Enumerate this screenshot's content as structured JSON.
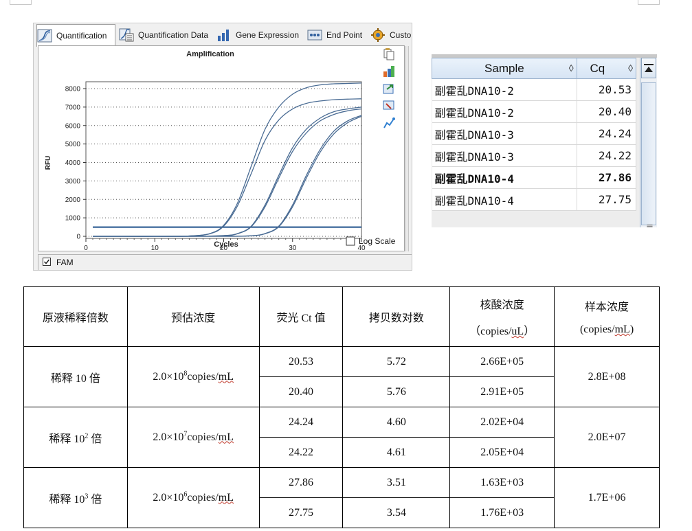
{
  "tabs": [
    {
      "label": "Quantification",
      "icon": "quantification-icon",
      "active": true
    },
    {
      "label": "Quantification Data",
      "icon": "quantification-data-icon",
      "active": false
    },
    {
      "label": "Gene Expression",
      "icon": "gene-expression-icon",
      "active": false
    },
    {
      "label": "End Point",
      "icon": "end-point-icon",
      "active": false
    },
    {
      "label": "Custo",
      "icon": "custom-gear-icon",
      "active": false
    }
  ],
  "fam_label": "FAM",
  "log_scale_label": "Log Scale",
  "chart_data": {
    "type": "line",
    "title": "Amplification",
    "xlabel": "Cycles",
    "ylabel": "RFU",
    "xlim": [
      0,
      40
    ],
    "ylim": [
      0,
      8000
    ],
    "xticks": [
      0,
      10,
      20,
      30,
      40
    ],
    "yticks": [
      0,
      1000,
      2000,
      3000,
      4000,
      5000,
      6000,
      7000,
      8000
    ],
    "grid": true,
    "threshold": 500,
    "line_color": "#4a6c94",
    "series": [
      {
        "x": [
          1,
          5,
          10,
          15,
          18,
          20,
          22,
          24,
          26,
          28,
          30,
          32,
          34,
          36,
          38,
          40
        ],
        "y": [
          0,
          0,
          0,
          20,
          150,
          600,
          1800,
          3800,
          5800,
          7000,
          7700,
          8050,
          8200,
          8260,
          8280,
          8300
        ]
      },
      {
        "x": [
          1,
          5,
          10,
          15,
          18,
          20,
          22,
          24,
          26,
          28,
          30,
          32,
          34,
          36,
          38,
          40
        ],
        "y": [
          0,
          0,
          0,
          20,
          140,
          550,
          1650,
          3400,
          5200,
          6300,
          6900,
          7200,
          7330,
          7400,
          7430,
          7450
        ]
      },
      {
        "x": [
          1,
          5,
          10,
          15,
          20,
          22,
          24,
          26,
          28,
          30,
          32,
          34,
          36,
          38,
          40
        ],
        "y": [
          0,
          0,
          0,
          0,
          40,
          150,
          550,
          1700,
          3300,
          4800,
          5800,
          6400,
          6750,
          6900,
          7000
        ]
      },
      {
        "x": [
          1,
          5,
          10,
          15,
          20,
          22,
          24,
          26,
          28,
          30,
          32,
          34,
          36,
          38,
          40
        ],
        "y": [
          0,
          0,
          0,
          0,
          30,
          140,
          520,
          1600,
          3150,
          4600,
          5600,
          6250,
          6600,
          6800,
          6900
        ]
      },
      {
        "x": [
          1,
          5,
          10,
          15,
          20,
          24,
          26,
          28,
          30,
          32,
          34,
          36,
          38,
          40
        ],
        "y": [
          0,
          0,
          0,
          0,
          0,
          30,
          150,
          550,
          1700,
          3300,
          4700,
          5700,
          6250,
          6550
        ]
      },
      {
        "x": [
          1,
          5,
          10,
          15,
          20,
          24,
          26,
          28,
          30,
          32,
          34,
          36,
          38,
          40
        ],
        "y": [
          0,
          0,
          0,
          0,
          0,
          25,
          140,
          520,
          1600,
          3150,
          4550,
          5550,
          6150,
          6500
        ]
      }
    ]
  },
  "sample_table": {
    "headers": [
      "Sample",
      "Cq"
    ],
    "sort_glyph": "◊",
    "rows": [
      {
        "sample": "副霍乱DNA10-2",
        "cq": "20.53",
        "bold": false
      },
      {
        "sample": "副霍乱DNA10-2",
        "cq": "20.40",
        "bold": false
      },
      {
        "sample": "副霍乱DNA10-3",
        "cq": "24.24",
        "bold": false
      },
      {
        "sample": "副霍乱DNA10-3",
        "cq": "24.22",
        "bold": false
      },
      {
        "sample": "副霍乱DNA10-4",
        "cq": "27.86",
        "bold": true
      },
      {
        "sample": "副霍乱DNA10-4",
        "cq": "27.75",
        "bold": false
      }
    ]
  },
  "results": {
    "headers": {
      "dilution": "原液稀释倍数",
      "est_conc": "预估浓度",
      "ct": "荧光 Ct 值",
      "log_copies": "拷贝数对数",
      "nucleic_line1": "核酸浓度",
      "nucleic_line2_a": "（copies/",
      "nucleic_line2_u": "uL",
      "nucleic_line2_b": "）",
      "sample_line1": "样本浓度",
      "sample_line2_a": "(copies/",
      "sample_line2_u": "mL",
      "sample_line2_b": ")"
    },
    "groups": [
      {
        "dil_a": "稀释 10",
        "dil_sup": "",
        "dil_b": " 倍",
        "est_a": "2.0×10",
        "est_sup": "8",
        "est_b": "copies/",
        "est_u": "mL",
        "sample": "2.8E+08",
        "rows": [
          {
            "ct": "20.53",
            "log": "5.72",
            "nucleic": "2.66E+05"
          },
          {
            "ct": "20.40",
            "log": "5.76",
            "nucleic": "2.91E+05"
          }
        ]
      },
      {
        "dil_a": "稀释 10",
        "dil_sup": "2",
        "dil_b": " 倍",
        "est_a": "2.0×10",
        "est_sup": "7",
        "est_b": "copies/",
        "est_u": "mL",
        "sample": "2.0E+07",
        "rows": [
          {
            "ct": "24.24",
            "log": "4.60",
            "nucleic": "2.02E+04"
          },
          {
            "ct": "24.22",
            "log": "4.61",
            "nucleic": "2.05E+04"
          }
        ]
      },
      {
        "dil_a": "稀释 10",
        "dil_sup": "3",
        "dil_b": " 倍",
        "est_a": "2.0×10",
        "est_sup": "6",
        "est_b": "copies/",
        "est_u": "mL",
        "sample": "1.7E+06",
        "rows": [
          {
            "ct": "27.86",
            "log": "3.51",
            "nucleic": "1.63E+03"
          },
          {
            "ct": "27.75",
            "log": "3.54",
            "nucleic": "1.76E+03"
          }
        ]
      }
    ]
  }
}
